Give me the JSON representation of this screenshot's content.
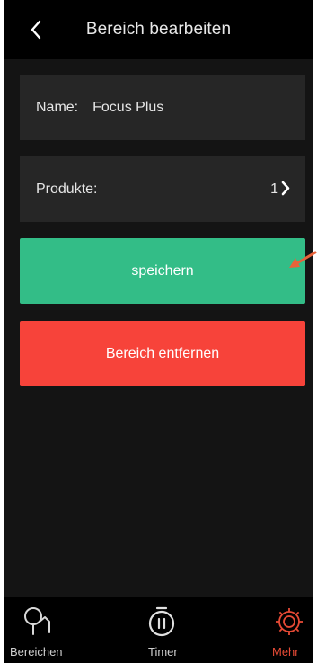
{
  "header": {
    "title": "Bereich bearbeiten",
    "back_icon": "chevron-left-icon"
  },
  "form": {
    "name_label": "Name:",
    "name_value": "Focus Plus",
    "products_label": "Produkte:",
    "products_count": "1"
  },
  "actions": {
    "save_label": "speichern",
    "remove_label": "Bereich entfernen"
  },
  "tabbar": {
    "items": [
      {
        "label": "Bereichen",
        "icon": "areas-pin-icon",
        "active": false
      },
      {
        "label": "Timer",
        "icon": "stopwatch-icon",
        "active": false
      },
      {
        "label": "Mehr",
        "icon": "gear-icon",
        "active": true
      }
    ]
  },
  "colors": {
    "background": "#141414",
    "header": "#000000",
    "row": "#262626",
    "save": "#33bd87",
    "remove": "#f7433a",
    "active_tab": "#e64a35",
    "annotation_arrow": "#e8623a"
  }
}
